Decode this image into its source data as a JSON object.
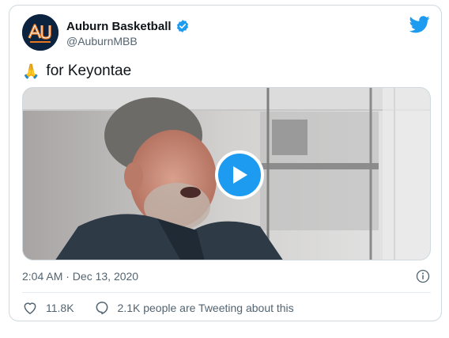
{
  "account": {
    "name": "Auburn Basketball",
    "handle": "@AuburnMBB",
    "verified_icon": "verified-badge-icon",
    "avatar_text": "AU",
    "avatar_subtext": "BASKETBALL"
  },
  "tweet": {
    "emoji": "🙏",
    "text": "for Keyontae",
    "timestamp": "2:04 AM · Dec 13, 2020"
  },
  "media": {
    "type": "video",
    "play_icon": "play-icon"
  },
  "engagement": {
    "likes": "11.8K",
    "replies_text": "2.1K people are Tweeting about this"
  },
  "colors": {
    "accent": "#1d9bf0",
    "secondary_text": "#536471",
    "border": "#cfd9de",
    "avatar_bg": "#0c2340",
    "avatar_orange": "#e87722"
  }
}
